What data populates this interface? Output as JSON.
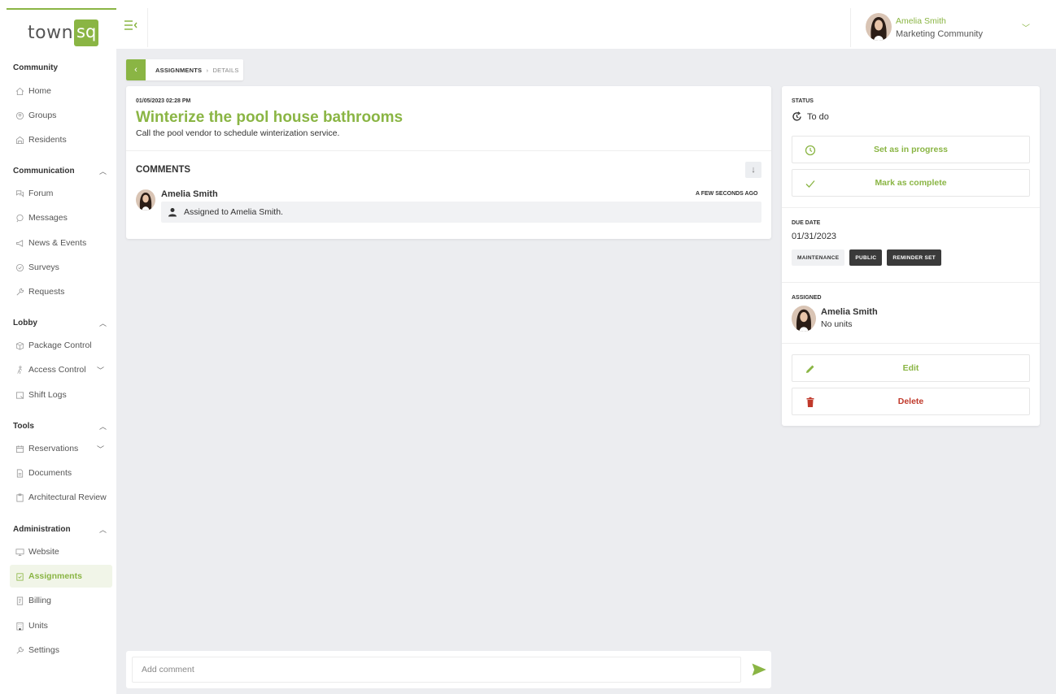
{
  "brand": {
    "name_left": "town",
    "name_right": "sq",
    "accent": "#8ab544",
    "danger": "#c0392b"
  },
  "user": {
    "name": "Amelia Smith",
    "community": "Marketing Community"
  },
  "sidebar": {
    "sections": [
      {
        "title": "Community",
        "items": [
          "Home",
          "Groups",
          "Residents"
        ]
      },
      {
        "title": "Communication",
        "items": [
          "Forum",
          "Messages",
          "News & Events",
          "Surveys",
          "Requests"
        ]
      },
      {
        "title": "Lobby",
        "items": [
          "Package Control",
          "Access Control",
          "Shift Logs"
        ]
      },
      {
        "title": "Tools",
        "items": [
          "Reservations",
          "Documents",
          "Architectural Review"
        ]
      },
      {
        "title": "Administration",
        "items": [
          "Website",
          "Assignments",
          "Billing",
          "Units",
          "Settings"
        ]
      }
    ]
  },
  "breadcrumb": {
    "parent": "ASSIGNMENTS",
    "separator": "›",
    "current": "DETAILS"
  },
  "assignment": {
    "created": "01/05/2023 02:28 PM",
    "title": "Winterize the pool house bathrooms",
    "description": "Call the pool vendor to schedule winterization service."
  },
  "comments": {
    "heading": "COMMENTS",
    "items": [
      {
        "author": "Amelia Smith",
        "time": "A FEW SECONDS AGO",
        "text": "Assigned to Amelia Smith."
      }
    ],
    "input_placeholder": "Add comment"
  },
  "side": {
    "status_label": "STATUS",
    "status_value": "To do",
    "progress_button": "Set as in progress",
    "complete_button": "Mark as complete",
    "due_label": "DUE DATE",
    "due_value": "01/31/2023",
    "tags": [
      "MAINTENANCE",
      "PUBLIC",
      "REMINDER SET"
    ],
    "assigned_label": "ASSIGNED",
    "assignee_name": "Amelia Smith",
    "assignee_units": "No units",
    "edit_button": "Edit",
    "delete_button": "Delete"
  }
}
